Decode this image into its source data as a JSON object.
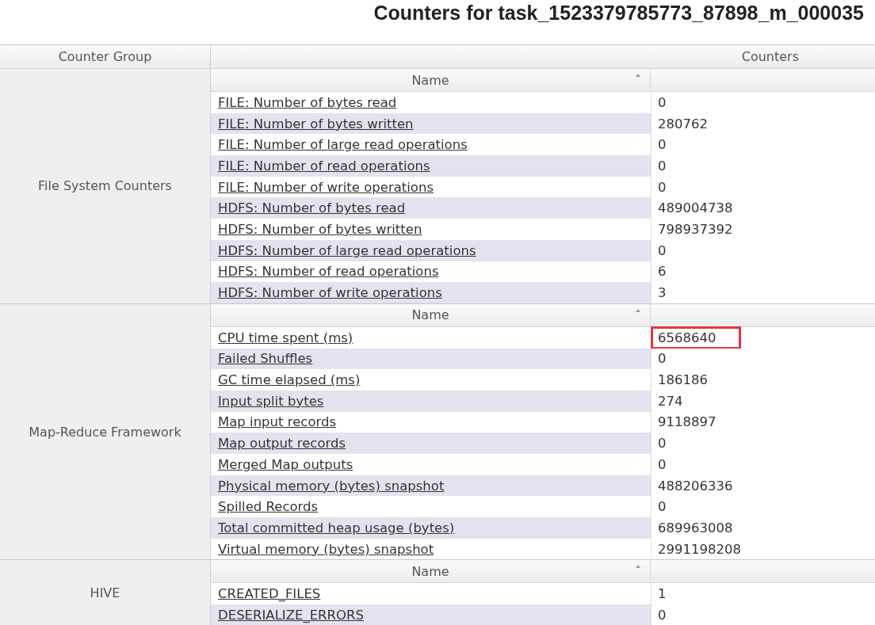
{
  "title": "Counters for task_1523379785773_87898_m_000035",
  "table": {
    "columns": [
      "Counter Group",
      "Counters"
    ],
    "groups": [
      {
        "name": "File System Counters",
        "name_column": "Name",
        "counters": [
          {
            "name": "FILE: Number of bytes read",
            "value": "0",
            "highlighted": false
          },
          {
            "name": "FILE: Number of bytes written",
            "value": "280762",
            "highlighted": false
          },
          {
            "name": "FILE: Number of large read operations",
            "value": "0",
            "highlighted": false
          },
          {
            "name": "FILE: Number of read operations",
            "value": "0",
            "highlighted": false
          },
          {
            "name": "FILE: Number of write operations",
            "value": "0",
            "highlighted": false
          },
          {
            "name": "HDFS: Number of bytes read",
            "value": "489004738",
            "highlighted": false
          },
          {
            "name": "HDFS: Number of bytes written",
            "value": "798937392",
            "highlighted": false
          },
          {
            "name": "HDFS: Number of large read operations",
            "value": "0",
            "highlighted": false
          },
          {
            "name": "HDFS: Number of read operations",
            "value": "6",
            "highlighted": false
          },
          {
            "name": "HDFS: Number of write operations",
            "value": "3",
            "highlighted": false
          }
        ]
      },
      {
        "name": "Map-Reduce Framework",
        "name_column": "Name",
        "counters": [
          {
            "name": "CPU time spent (ms)",
            "value": "6568640",
            "highlighted": true
          },
          {
            "name": "Failed Shuffles",
            "value": "0",
            "highlighted": false
          },
          {
            "name": "GC time elapsed (ms)",
            "value": "186186",
            "highlighted": false
          },
          {
            "name": "Input split bytes",
            "value": "274",
            "highlighted": false
          },
          {
            "name": "Map input records",
            "value": "9118897",
            "highlighted": false
          },
          {
            "name": "Map output records",
            "value": "0",
            "highlighted": false
          },
          {
            "name": "Merged Map outputs",
            "value": "0",
            "highlighted": false
          },
          {
            "name": "Physical memory (bytes) snapshot",
            "value": "488206336",
            "highlighted": false
          },
          {
            "name": "Spilled Records",
            "value": "0",
            "highlighted": false
          },
          {
            "name": "Total committed heap usage (bytes)",
            "value": "689963008",
            "highlighted": false
          },
          {
            "name": "Virtual memory (bytes) snapshot",
            "value": "2991198208",
            "highlighted": false
          }
        ]
      },
      {
        "name": "HIVE",
        "name_column": "Name",
        "counters": [
          {
            "name": "CREATED_FILES",
            "value": "1",
            "highlighted": false
          },
          {
            "name": "DESERIALIZE_ERRORS",
            "value": "0",
            "highlighted": false
          }
        ]
      }
    ]
  }
}
